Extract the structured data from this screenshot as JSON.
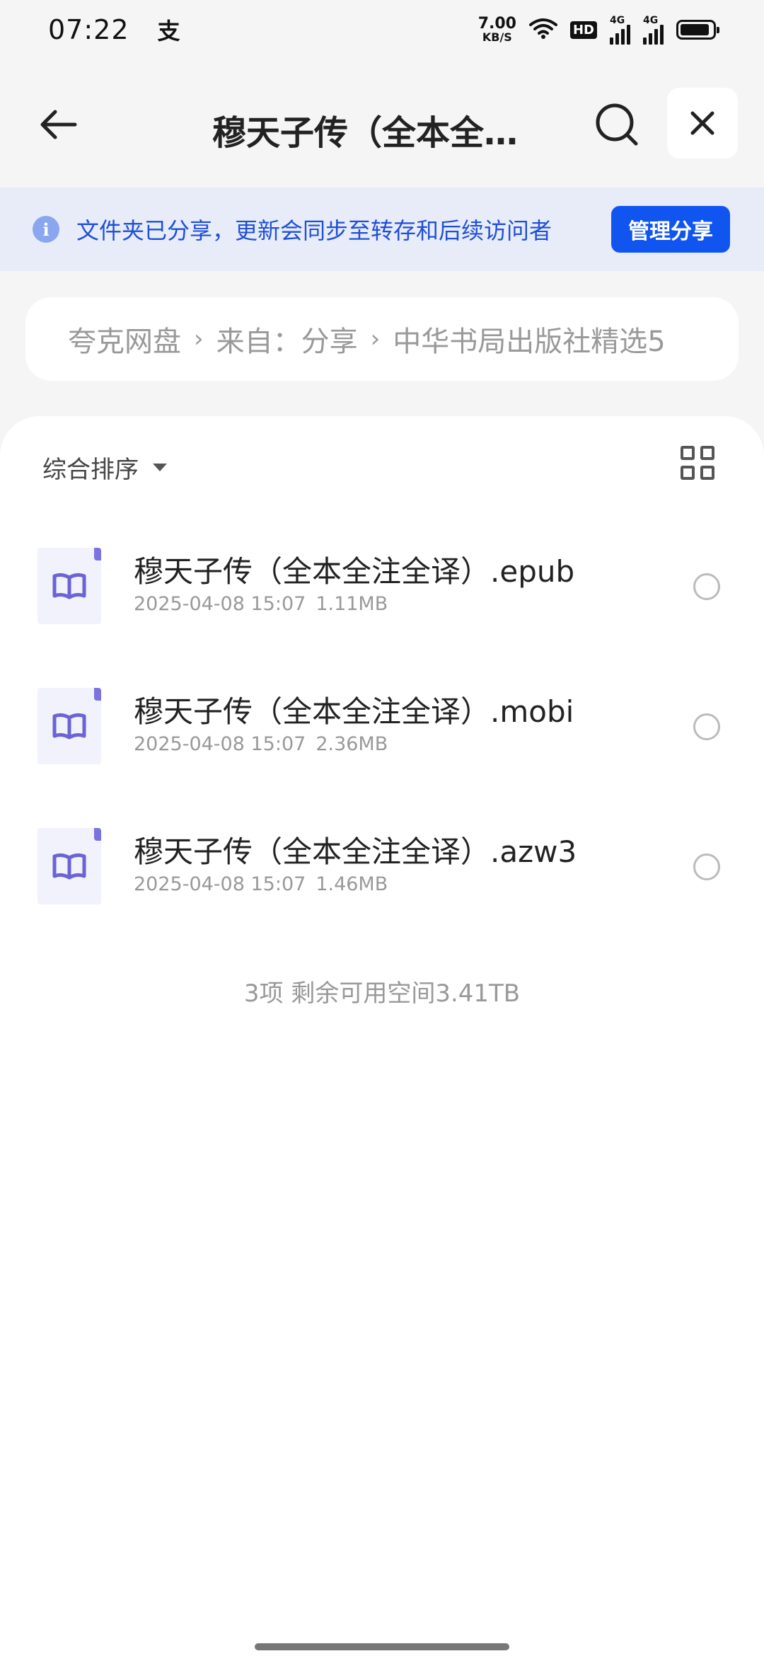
{
  "status": {
    "time": "07:22",
    "left_icon": "支",
    "net_speed_value": "7.00",
    "net_speed_unit": "KB/S",
    "hd_badge": "HD",
    "signal1_label": "4G",
    "signal2_label": "4G",
    "icons": [
      "wifi-icon",
      "hd-icon",
      "signal-icon",
      "signal-icon",
      "battery-icon"
    ],
    "battery_level": 0.9
  },
  "header": {
    "title": "穆天子传（全本全…",
    "icons": [
      "back-arrow-icon",
      "search-icon",
      "close-icon"
    ]
  },
  "banner": {
    "info_icon": "i",
    "text": "文件夹已分享，更新会同步至转存和后续访问者",
    "manage_label": "管理分享"
  },
  "breadcrumb": {
    "items": [
      "夸克网盘",
      "来自：分享",
      "中华书局出版社精选5"
    ],
    "separator": "›"
  },
  "sort": {
    "label": "综合排序",
    "icons": [
      "caret-down-icon",
      "grid-view-icon"
    ]
  },
  "files": [
    {
      "name": "穆天子传（全本全注全译）.epub",
      "date": "2025-04-08 15:07",
      "size": "1.11MB"
    },
    {
      "name": "穆天子传（全本全注全译）.mobi",
      "date": "2025-04-08 15:07",
      "size": "2.36MB"
    },
    {
      "name": "穆天子传（全本全注全译）.azw3",
      "date": "2025-04-08 15:07",
      "size": "1.46MB"
    }
  ],
  "footer": {
    "count_text": "3项 剩余可用空间3.41TB"
  },
  "colors": {
    "accent": "#1155f0",
    "banner_bg": "#e7ecf8",
    "banner_text": "#1f4fd8",
    "file_icon": "#6b63d6"
  }
}
